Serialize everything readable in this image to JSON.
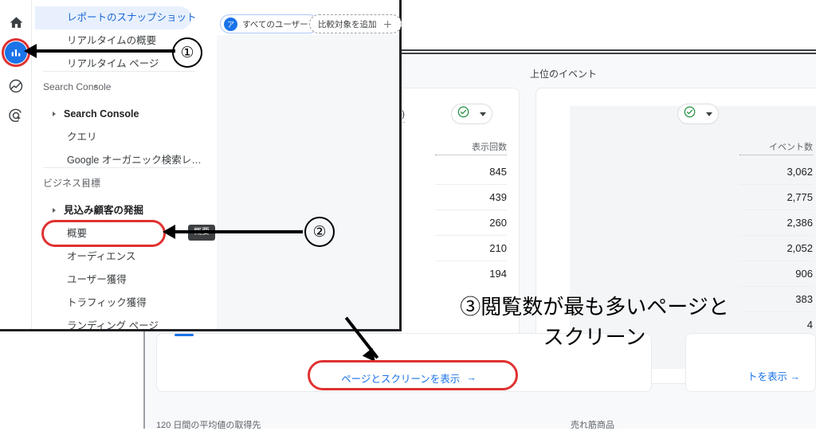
{
  "app": {
    "name": "Google Analytics 4 report navigation",
    "accent_blue": "#1a73e8",
    "highlight_red": "#e03131",
    "check_green": "#1e8e3e"
  },
  "icon_rail": {
    "items": [
      {
        "name": "home-icon",
        "label": "ホーム",
        "active": false
      },
      {
        "name": "reports-icon",
        "label": "レポート",
        "active": true
      },
      {
        "name": "explore-icon",
        "label": "探索",
        "active": false
      },
      {
        "name": "advertising-icon",
        "label": "広告",
        "active": false
      }
    ]
  },
  "sidebar": {
    "items": [
      {
        "label": "レポートのスナップショット",
        "selected": true,
        "type": "item"
      },
      {
        "label": "リアルタイムの概要",
        "selected": false,
        "type": "item"
      },
      {
        "label": "リアルタイム ページ",
        "selected": false,
        "type": "item"
      },
      {
        "label": "Search Console",
        "selected": false,
        "type": "section",
        "caret": "˄"
      },
      {
        "label": "Search Console",
        "selected": false,
        "type": "group"
      },
      {
        "label": "クエリ",
        "selected": false,
        "type": "child"
      },
      {
        "label": "Google オーガニック検索レ…",
        "selected": false,
        "type": "child"
      },
      {
        "label": "ビジネス目標",
        "selected": false,
        "type": "section",
        "caret": "˄"
      },
      {
        "label": "見込み顧客の発掘",
        "selected": false,
        "type": "group"
      },
      {
        "label": "概要",
        "selected": false,
        "type": "child",
        "highlighted": true
      },
      {
        "label": "オーディエンス",
        "selected": false,
        "type": "child"
      },
      {
        "label": "ユーザー獲得",
        "selected": false,
        "type": "child"
      },
      {
        "label": "トラフィック獲得",
        "selected": false,
        "type": "child"
      },
      {
        "label": "ランディング ページ",
        "selected": false,
        "type": "child"
      }
    ]
  },
  "toolbar": {
    "all_users_pill": "すべてのユーザー",
    "all_users_badge": "ア",
    "compare_pill": "比較対象を追加",
    "compare_plus": "＋"
  },
  "cards": {
    "left_card": {
      "truncated_label": "ス)",
      "metric_header": "表示回数",
      "values": [
        "845",
        "439",
        "260",
        "210",
        "194"
      ]
    },
    "right_card": {
      "title": "上位のイベント",
      "metric_header": "イベント数",
      "values": [
        "3,062",
        "2,775",
        "2,386",
        "2,052",
        "906",
        "383",
        "4"
      ]
    },
    "view_pages_link": "ページとスクリーンを表示",
    "view_pages_arrow": "→",
    "view_events_link": "トを表示",
    "view_events_arrow": "→"
  },
  "bottom_labels": {
    "left": "120 日間の平均値の取得先",
    "right": "売れ筋商品"
  },
  "annotations": {
    "step1": "①",
    "step2": "②",
    "step2_tooltip": "概要",
    "step3_number": "③",
    "step3_line1": "③閲覧数が最も多いページと",
    "step3_line2": "スクリーン"
  }
}
